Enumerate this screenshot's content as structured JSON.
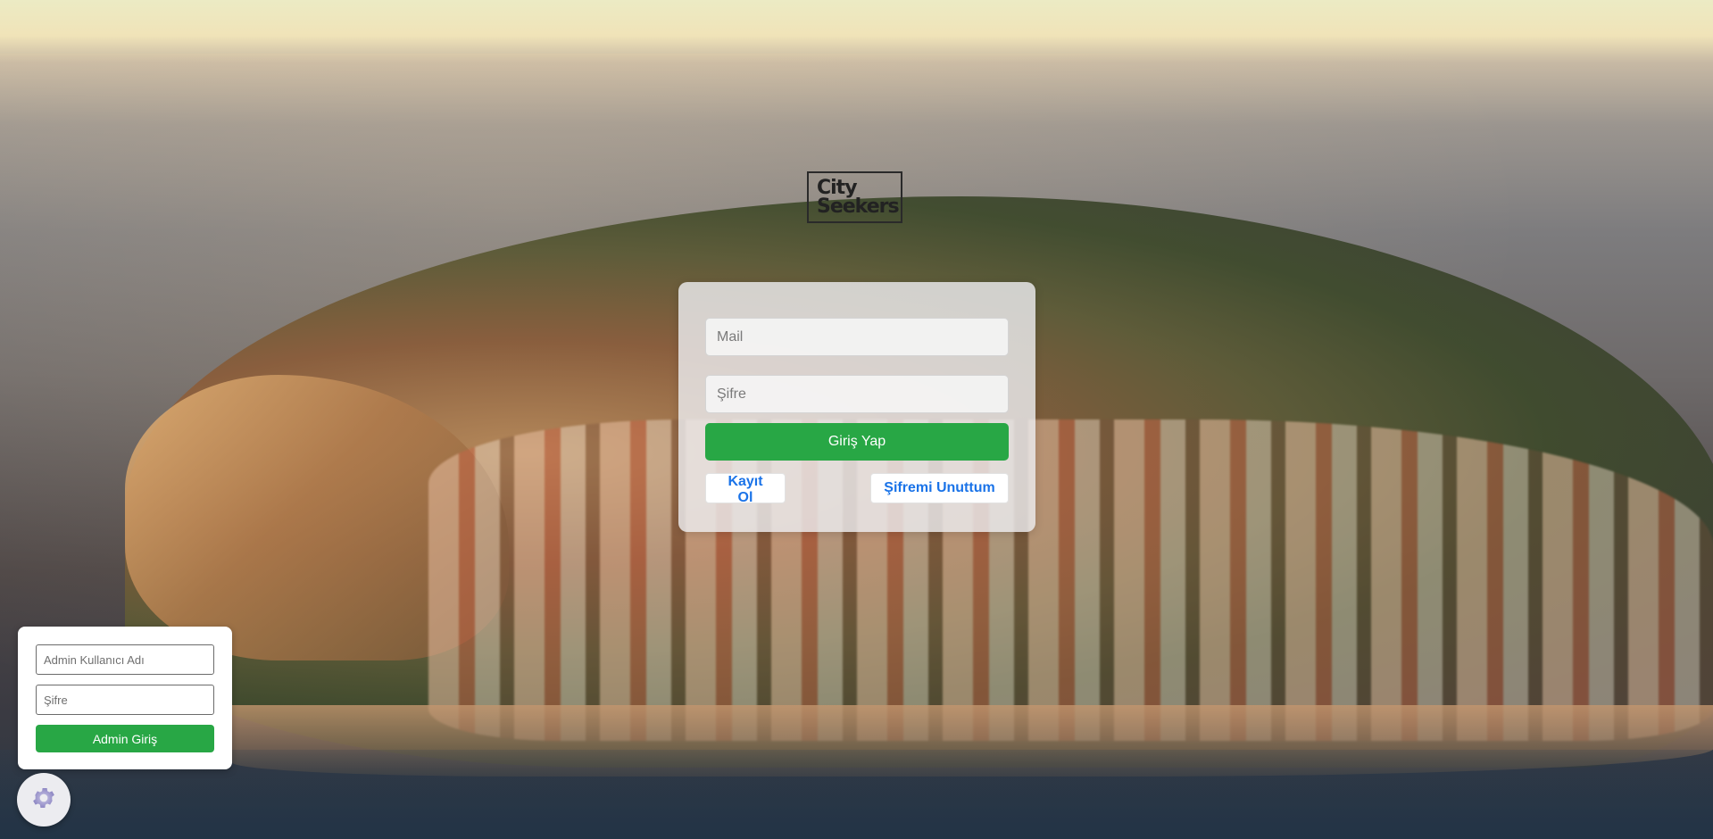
{
  "logo": {
    "line1": "City",
    "line2": "Seekers"
  },
  "login": {
    "mail_placeholder": "Mail",
    "password_placeholder": "Şifre",
    "submit_label": "Giriş Yap",
    "register_label": "Kayıt Ol",
    "forgot_label": "Şifremi Unuttum"
  },
  "admin": {
    "username_placeholder": "Admin Kullanıcı Adı",
    "password_placeholder": "Şifre",
    "submit_label": "Admin Giriş"
  },
  "icons": {
    "settings": "gear-icon"
  },
  "colors": {
    "primary_button": "#28a745",
    "link_text": "#1a73e8"
  }
}
